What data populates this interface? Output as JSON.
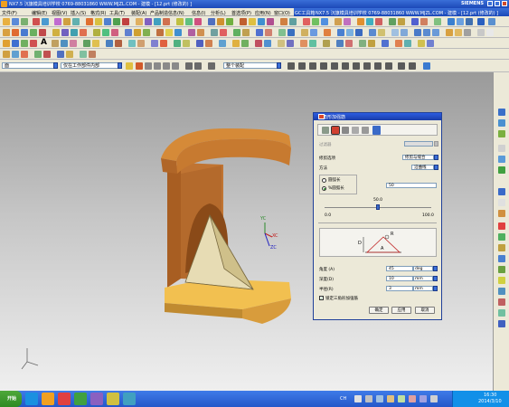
{
  "app": {
    "title": "NX7.5  沉旗模具培训学校  0769-88031860  WWW.MJZL.COM - 建模 - [12.prt (修改的) ]",
    "brand": "SIEMENS",
    "gc_bar_text": "NX7.5  沉旗模具培训学校  0769-88031860  WWW.MJZL.COM - 建模 - [12.prt (修改的) ]"
  },
  "menu": {
    "items": [
      "文件(F)",
      "编辑(E)",
      "视图(V)",
      "插入(S)",
      "格式(R)",
      "工具(T)",
      "装配(A)",
      "产品制造信息(N)",
      "信息(I)",
      "分析(L)",
      "首选项(P)",
      "应用(N)",
      "窗口(O)",
      "GC工具箱"
    ]
  },
  "selection_bar": {
    "filter_value": "面",
    "scope_value": "仅在工作部件内部",
    "snap_value": "整个装配"
  },
  "dialog": {
    "title": "三角形加强筋",
    "section_filter_label": "过滤器",
    "placement_label": "修剪选项",
    "placement_value": "修剪与缝合",
    "method_label": "方法",
    "method_value": "沿曲线",
    "radio_arc_length": "圆弧长",
    "radio_percent_arc": "%圆弧长",
    "percent_value": "50",
    "slider_value_label": "50.0",
    "slider_min": "0.0",
    "slider_max": "100.0",
    "slider_fraction": 0.5,
    "angle_label": "角度 (A)",
    "angle_value": "45",
    "angle_unit": "deg",
    "depth_label": "深度(D)",
    "depth_value": "10",
    "depth_unit": "mm",
    "radius_label": "半径(R)",
    "radius_value": "3",
    "radius_unit": "mm",
    "lock_checkbox_label": "锁定三角形加强筋",
    "ok_label": "确定",
    "apply_label": "应用",
    "cancel_label": "取消",
    "diagram_labels": {
      "d": "D",
      "r": "R",
      "a": "A"
    }
  },
  "viewport": {
    "axis_labels": {
      "xc": "XC",
      "yc": "YC",
      "zc": "ZC"
    },
    "colors": {
      "part_body": "#c87a2e",
      "part_face": "#f2c050",
      "rib": "#d8cfa0"
    }
  },
  "taskbar": {
    "start_label": "开始",
    "clock_time": "16:30",
    "clock_date": "2014/3/10",
    "tray_ime": "CH"
  }
}
